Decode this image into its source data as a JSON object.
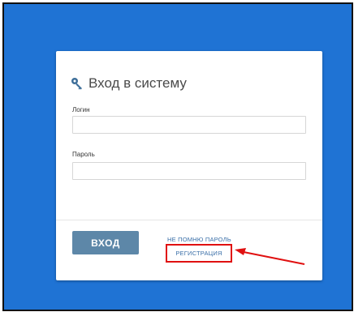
{
  "login_form": {
    "title": "Вход в систему",
    "login_label": "Логин",
    "login_value": "",
    "password_label": "Пароль",
    "password_value": "",
    "submit_label": "ВХОД",
    "forgot_password_link": "НЕ ПОМНЮ ПАРОЛЬ",
    "register_link": "РЕГИСТРАЦИЯ"
  },
  "icons": {
    "title_icon": "key-icon",
    "annotation": "red-arrow-icon"
  },
  "colors": {
    "background": "#1f73d4",
    "button": "#5d87a8",
    "link": "#3a6fa8",
    "highlight": "#e01010"
  }
}
